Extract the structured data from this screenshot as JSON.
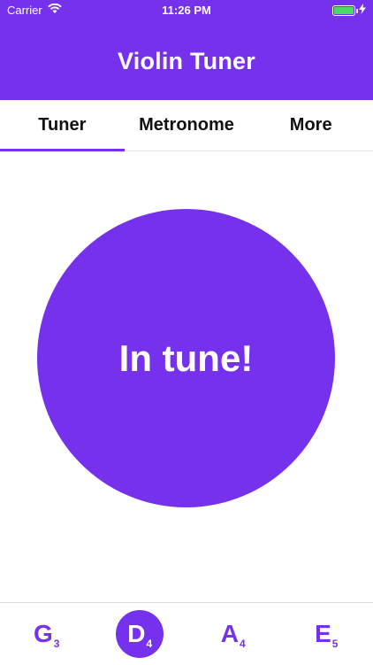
{
  "status_bar": {
    "carrier": "Carrier",
    "time": "11:26 PM",
    "battery_level": 1.0,
    "battery_color": "#4cd964"
  },
  "header": {
    "title": "Violin Tuner",
    "background": "#7531ec"
  },
  "tabs": [
    {
      "label": "Tuner",
      "active": true
    },
    {
      "label": "Metronome",
      "active": false
    },
    {
      "label": "More",
      "active": false
    }
  ],
  "tuner": {
    "status_text": "In tune!",
    "circle_color": "#7531ec"
  },
  "strings": [
    {
      "note": "G",
      "octave": "3",
      "selected": false
    },
    {
      "note": "D",
      "octave": "4",
      "selected": true
    },
    {
      "note": "A",
      "octave": "4",
      "selected": false
    },
    {
      "note": "E",
      "octave": "5",
      "selected": false
    }
  ],
  "accent_color": "#7531ec"
}
